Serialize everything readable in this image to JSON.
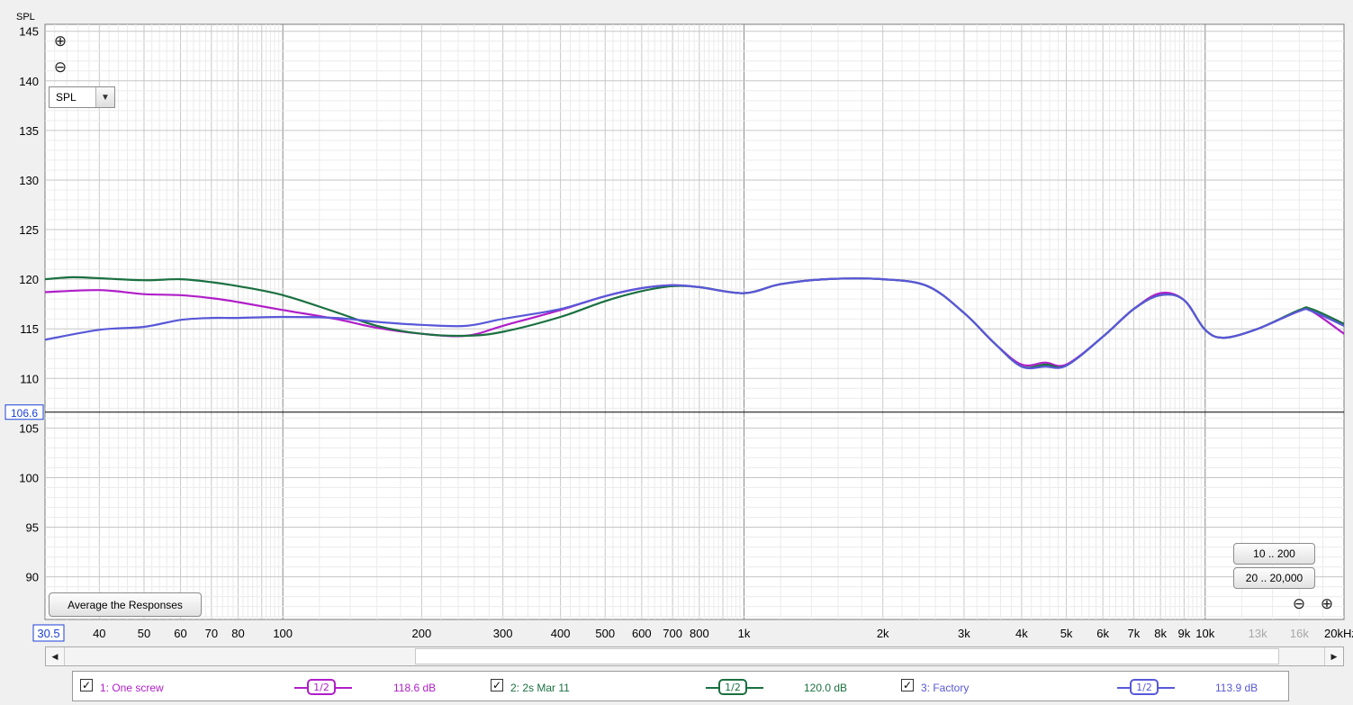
{
  "chart_data": {
    "type": "line",
    "ylabel": "SPL",
    "xlabel": "",
    "x_scale": "log",
    "xlim": [
      30.5,
      20000
    ],
    "ylim": [
      85.7,
      145.7
    ],
    "y_ticks": [
      90,
      95,
      100,
      105,
      110,
      115,
      120,
      125,
      130,
      135,
      140,
      145
    ],
    "x_ticks": [
      {
        "v": 40,
        "label": "40"
      },
      {
        "v": 50,
        "label": "50"
      },
      {
        "v": 60,
        "label": "60"
      },
      {
        "v": 70,
        "label": "70"
      },
      {
        "v": 80,
        "label": "80"
      },
      {
        "v": 100,
        "label": "100"
      },
      {
        "v": 200,
        "label": "200"
      },
      {
        "v": 300,
        "label": "300"
      },
      {
        "v": 400,
        "label": "400"
      },
      {
        "v": 500,
        "label": "500"
      },
      {
        "v": 600,
        "label": "600"
      },
      {
        "v": 700,
        "label": "700"
      },
      {
        "v": 800,
        "label": "800"
      },
      {
        "v": 1000,
        "label": "1k"
      },
      {
        "v": 2000,
        "label": "2k"
      },
      {
        "v": 3000,
        "label": "3k"
      },
      {
        "v": 4000,
        "label": "4k"
      },
      {
        "v": 5000,
        "label": "5k"
      },
      {
        "v": 6000,
        "label": "6k"
      },
      {
        "v": 7000,
        "label": "7k"
      },
      {
        "v": 8000,
        "label": "8k"
      },
      {
        "v": 9000,
        "label": "9k"
      },
      {
        "v": 10000,
        "label": "10k"
      },
      {
        "v": 13000,
        "label": "13k",
        "dim": true
      },
      {
        "v": 16000,
        "label": "16k",
        "dim": true
      },
      {
        "v": 20000,
        "label": "20kHz"
      }
    ],
    "cursor": {
      "x_label": "30.5",
      "y_value": 106.6,
      "y_label": "106.6"
    },
    "series": [
      {
        "name": "1: One screw",
        "color": "#b01ec8",
        "points": [
          [
            30.5,
            118.7
          ],
          [
            40,
            118.9
          ],
          [
            50,
            118.5
          ],
          [
            60,
            118.4
          ],
          [
            70,
            118.1
          ],
          [
            80,
            117.7
          ],
          [
            100,
            116.9
          ],
          [
            130,
            116.0
          ],
          [
            160,
            115.1
          ],
          [
            200,
            114.5
          ],
          [
            250,
            114.3
          ],
          [
            300,
            115.3
          ],
          [
            400,
            116.9
          ],
          [
            500,
            118.3
          ],
          [
            600,
            119.1
          ],
          [
            700,
            119.4
          ],
          [
            800,
            119.2
          ],
          [
            1000,
            118.6
          ],
          [
            1200,
            119.5
          ],
          [
            1500,
            120.0
          ],
          [
            2000,
            120.0
          ],
          [
            2500,
            119.3
          ],
          [
            3000,
            116.6
          ],
          [
            3500,
            113.5
          ],
          [
            4000,
            111.4
          ],
          [
            4500,
            111.6
          ],
          [
            5000,
            111.4
          ],
          [
            6000,
            114.2
          ],
          [
            7000,
            117.0
          ],
          [
            8000,
            118.6
          ],
          [
            9000,
            117.9
          ],
          [
            10000,
            114.9
          ],
          [
            11000,
            114.1
          ],
          [
            13000,
            115.0
          ],
          [
            16000,
            116.8
          ],
          [
            17000,
            116.8
          ],
          [
            20000,
            114.5
          ]
        ]
      },
      {
        "name": "2: 2s Mar 11",
        "color": "#1a7040",
        "points": [
          [
            30.5,
            120.0
          ],
          [
            35,
            120.2
          ],
          [
            40,
            120.1
          ],
          [
            50,
            119.9
          ],
          [
            60,
            120.0
          ],
          [
            70,
            119.7
          ],
          [
            80,
            119.3
          ],
          [
            100,
            118.4
          ],
          [
            130,
            116.7
          ],
          [
            160,
            115.3
          ],
          [
            200,
            114.5
          ],
          [
            250,
            114.3
          ],
          [
            300,
            114.7
          ],
          [
            400,
            116.2
          ],
          [
            500,
            117.8
          ],
          [
            600,
            118.8
          ],
          [
            700,
            119.3
          ],
          [
            800,
            119.2
          ],
          [
            1000,
            118.6
          ],
          [
            1200,
            119.5
          ],
          [
            1500,
            120.0
          ],
          [
            2000,
            120.0
          ],
          [
            2500,
            119.3
          ],
          [
            3000,
            116.6
          ],
          [
            3500,
            113.5
          ],
          [
            4000,
            111.2
          ],
          [
            4500,
            111.4
          ],
          [
            5000,
            111.3
          ],
          [
            6000,
            114.2
          ],
          [
            7000,
            117.0
          ],
          [
            8000,
            118.4
          ],
          [
            9000,
            117.9
          ],
          [
            10000,
            114.9
          ],
          [
            11000,
            114.1
          ],
          [
            13000,
            115.0
          ],
          [
            16000,
            116.9
          ],
          [
            17000,
            117.0
          ],
          [
            20000,
            115.5
          ]
        ]
      },
      {
        "name": "3: Factory",
        "color": "#5858d8",
        "points": [
          [
            30.5,
            113.9
          ],
          [
            40,
            114.9
          ],
          [
            50,
            115.2
          ],
          [
            60,
            115.9
          ],
          [
            70,
            116.1
          ],
          [
            80,
            116.1
          ],
          [
            100,
            116.2
          ],
          [
            130,
            116.1
          ],
          [
            160,
            115.7
          ],
          [
            200,
            115.4
          ],
          [
            250,
            115.3
          ],
          [
            300,
            116.0
          ],
          [
            400,
            117.0
          ],
          [
            500,
            118.3
          ],
          [
            600,
            119.1
          ],
          [
            700,
            119.4
          ],
          [
            800,
            119.2
          ],
          [
            1000,
            118.6
          ],
          [
            1200,
            119.5
          ],
          [
            1500,
            120.0
          ],
          [
            2000,
            120.0
          ],
          [
            2500,
            119.3
          ],
          [
            3000,
            116.6
          ],
          [
            3500,
            113.5
          ],
          [
            4000,
            111.2
          ],
          [
            4500,
            111.2
          ],
          [
            5000,
            111.3
          ],
          [
            6000,
            114.2
          ],
          [
            7000,
            117.0
          ],
          [
            8000,
            118.4
          ],
          [
            9000,
            117.9
          ],
          [
            10000,
            114.9
          ],
          [
            11000,
            114.1
          ],
          [
            13000,
            115.0
          ],
          [
            16000,
            116.8
          ],
          [
            17000,
            116.8
          ],
          [
            20000,
            115.3
          ]
        ]
      }
    ]
  },
  "controls": {
    "mode_select_value": "SPL",
    "zoom_in_icon": "⊕",
    "zoom_out_icon": "⊖",
    "range_button_1": "10 .. 200",
    "range_button_2": "20 .. 20,000",
    "average_button": "Average the Responses",
    "scroll_left_icon": "◀",
    "scroll_right_icon": "▶",
    "dropdown_icon": "▼",
    "check_mark": "✓"
  },
  "legend": [
    {
      "name": "1: One screw",
      "smoothing": "1/2",
      "db": "118.6 dB",
      "color": "#b01ec8",
      "checked": true
    },
    {
      "name": "2: 2s Mar 11",
      "smoothing": "1/2",
      "db": "120.0 dB",
      "color": "#1a7040",
      "checked": true
    },
    {
      "name": "3: Factory",
      "smoothing": "1/2",
      "db": "113.9 dB",
      "color": "#5858d8",
      "checked": true
    }
  ]
}
